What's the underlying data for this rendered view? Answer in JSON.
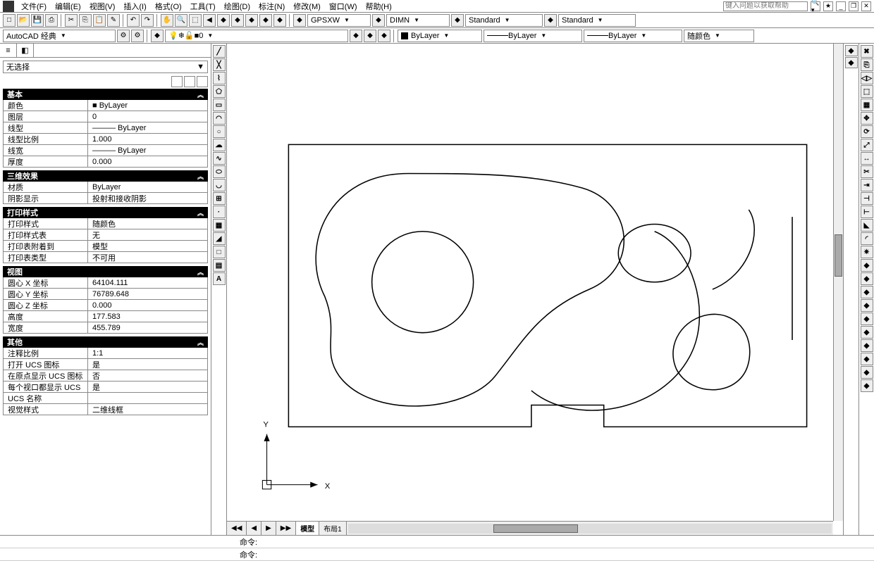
{
  "menubar": {
    "items": [
      "文件(F)",
      "编辑(E)",
      "视图(V)",
      "插入(I)",
      "格式(O)",
      "工具(T)",
      "绘图(D)",
      "标注(N)",
      "修改(M)",
      "窗口(W)",
      "帮助(H)"
    ],
    "help_placeholder": "键入问题以获取帮助"
  },
  "toolbar1": {
    "combo1": "GPSXW",
    "combo2": "DIMN",
    "combo3": "Standard",
    "combo4": "Standard"
  },
  "toolbar2": {
    "workspace": "AutoCAD 经典",
    "layer": "0",
    "color_label": "ByLayer",
    "linetype_label": "ByLayer",
    "lineweight_label": "ByLayer",
    "plotstyle_label": "随颜色"
  },
  "props": {
    "selection": "无选择",
    "groups": [
      {
        "title": "基本",
        "rows": [
          {
            "label": "颜色",
            "value": "■ ByLayer"
          },
          {
            "label": "图层",
            "value": "0"
          },
          {
            "label": "线型",
            "value": "——— ByLayer"
          },
          {
            "label": "线型比例",
            "value": "1.000"
          },
          {
            "label": "线宽",
            "value": "——— ByLayer"
          },
          {
            "label": "厚度",
            "value": "0.000"
          }
        ]
      },
      {
        "title": "三维效果",
        "rows": [
          {
            "label": "材质",
            "value": "ByLayer"
          },
          {
            "label": "阴影显示",
            "value": "投射和接收阴影"
          }
        ]
      },
      {
        "title": "打印样式",
        "rows": [
          {
            "label": "打印样式",
            "value": "随颜色"
          },
          {
            "label": "打印样式表",
            "value": "无"
          },
          {
            "label": "打印表附着到",
            "value": "模型"
          },
          {
            "label": "打印表类型",
            "value": "不可用"
          }
        ]
      },
      {
        "title": "视图",
        "rows": [
          {
            "label": "圆心 X 坐标",
            "value": "64104.111"
          },
          {
            "label": "圆心 Y 坐标",
            "value": "76789.648"
          },
          {
            "label": "圆心 Z 坐标",
            "value": "0.000"
          },
          {
            "label": "高度",
            "value": "177.583"
          },
          {
            "label": "宽度",
            "value": "455.789"
          }
        ]
      },
      {
        "title": "其他",
        "rows": [
          {
            "label": "注释比例",
            "value": "1:1"
          },
          {
            "label": "打开 UCS 图标",
            "value": "是"
          },
          {
            "label": "在原点显示 UCS 图标",
            "value": "否"
          },
          {
            "label": "每个视口都显示 UCS",
            "value": "是"
          },
          {
            "label": "UCS 名称",
            "value": ""
          },
          {
            "label": "视觉样式",
            "value": "二维线框"
          }
        ]
      }
    ]
  },
  "layout_tabs": {
    "nav": [
      "◀◀",
      "◀",
      "▶",
      "▶▶"
    ],
    "tabs": [
      "模型",
      "布局1"
    ]
  },
  "axes": {
    "x": "X",
    "y": "Y"
  },
  "command": {
    "prompt": "命令:"
  }
}
